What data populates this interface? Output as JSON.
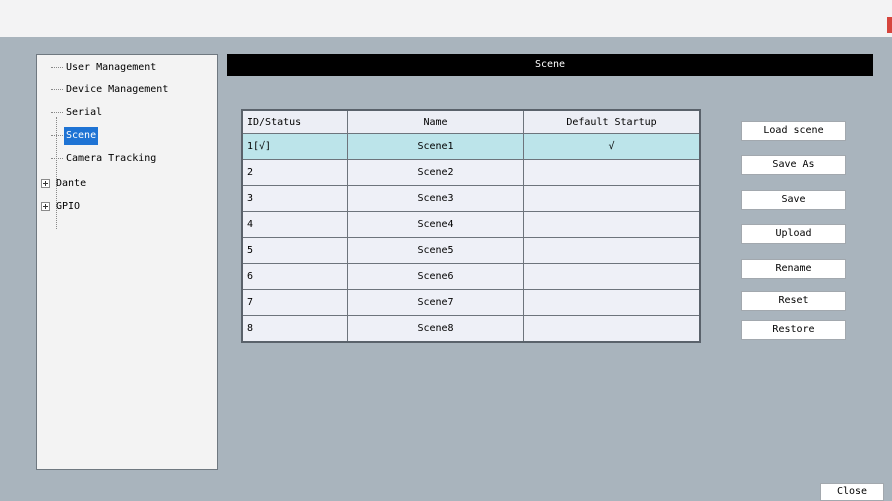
{
  "tree": {
    "items": [
      {
        "label": "User Management",
        "expandable": false,
        "selected": false
      },
      {
        "label": "Device Management",
        "expandable": false,
        "selected": false
      },
      {
        "label": "Serial",
        "expandable": false,
        "selected": false
      },
      {
        "label": "Scene",
        "expandable": false,
        "selected": true
      },
      {
        "label": "Camera Tracking",
        "expandable": false,
        "selected": false
      },
      {
        "label": "Dante",
        "expandable": true,
        "selected": false
      },
      {
        "label": "GPIO",
        "expandable": true,
        "selected": false
      }
    ]
  },
  "panel": {
    "title": "Scene"
  },
  "table": {
    "headers": [
      "ID/Status",
      "Name",
      "Default Startup"
    ],
    "rows": [
      [
        "1[√]",
        "Scene1",
        "√"
      ],
      [
        "2",
        "Scene2",
        ""
      ],
      [
        "3",
        "Scene3",
        ""
      ],
      [
        "4",
        "Scene4",
        ""
      ],
      [
        "5",
        "Scene5",
        ""
      ],
      [
        "6",
        "Scene6",
        ""
      ],
      [
        "7",
        "Scene7",
        ""
      ],
      [
        "8",
        "Scene8",
        ""
      ]
    ],
    "selected_row": 0
  },
  "buttons": {
    "load_scene": "Load scene",
    "save_as": "Save As",
    "save": "Save",
    "upload": "Upload",
    "rename": "Rename",
    "reset": "Reset",
    "restore": "Restore",
    "close": "Close"
  },
  "colors": {
    "selection_blue": "#1e73d4",
    "row_highlight": "#bce4ea",
    "header_bar": "#000000",
    "background": "#a9b4bd"
  }
}
